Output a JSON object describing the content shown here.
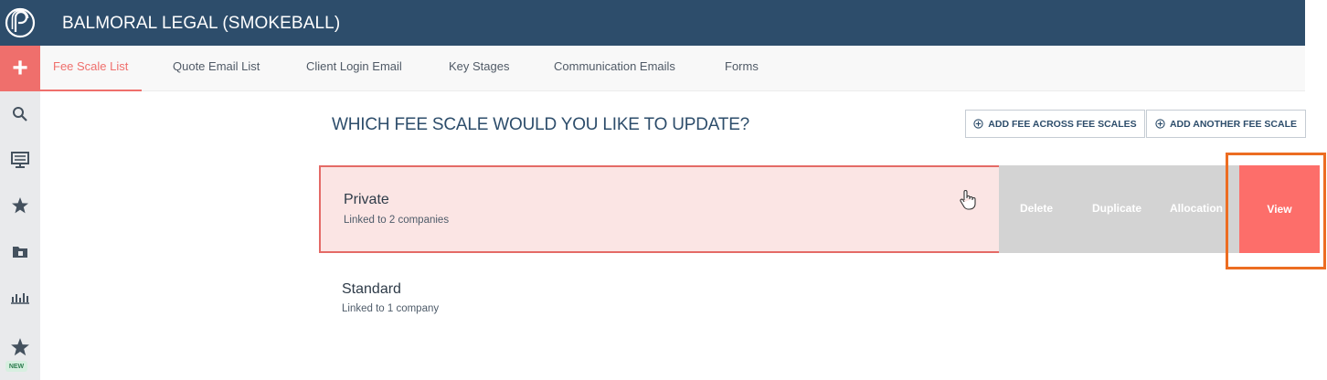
{
  "header": {
    "title": "BALMORAL LEGAL (SMOKEBALL)"
  },
  "rail": {
    "items": [
      "search-icon",
      "display-icon",
      "person-star-icon",
      "folder-icon",
      "chart-icon",
      "star-icon"
    ],
    "new_badge": "NEW"
  },
  "tabs": [
    {
      "label": "Fee Scale List",
      "active": true
    },
    {
      "label": "Quote Email List",
      "active": false
    },
    {
      "label": "Client Login Email",
      "active": false
    },
    {
      "label": "Key Stages",
      "active": false
    },
    {
      "label": "Communication Emails",
      "active": false
    },
    {
      "label": "Forms",
      "active": false
    }
  ],
  "main": {
    "question": "WHICH FEE SCALE WOULD YOU LIKE TO UPDATE?",
    "add_across_label": "ADD FEE ACROSS FEE SCALES",
    "add_another_label": "ADD ANOTHER FEE SCALE"
  },
  "fee_scales": [
    {
      "name": "Private",
      "linked": "Linked to 2 companies",
      "actions": {
        "delete": "Delete",
        "duplicate": "Duplicate",
        "allocation": "Allocation",
        "view": "View"
      }
    },
    {
      "name": "Standard",
      "linked": "Linked to 1 company"
    }
  ],
  "colors": {
    "header_bg": "#2d4d6b",
    "accent": "#ef6f6c",
    "selected_row_bg": "#fbe5e4",
    "action_bg": "#d3d3d3",
    "highlight": "#ec6d22"
  }
}
